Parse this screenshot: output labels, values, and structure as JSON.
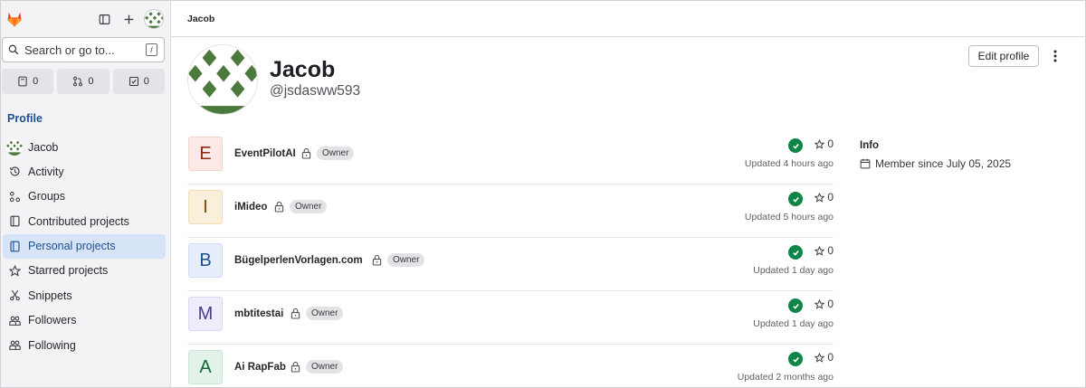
{
  "sidebar": {
    "search_label": "Search or go to...",
    "search_shortcut": "/",
    "counts": [
      {
        "icon": "issues-icon",
        "value": "0"
      },
      {
        "icon": "merge-request-icon",
        "value": "0"
      },
      {
        "icon": "todo-icon",
        "value": "0"
      }
    ],
    "section_title": "Profile",
    "items": [
      {
        "label": "Jacob",
        "icon": "user-avatar"
      },
      {
        "label": "Activity",
        "icon": "history-icon"
      },
      {
        "label": "Groups",
        "icon": "groups-icon"
      },
      {
        "label": "Contributed projects",
        "icon": "project-icon"
      },
      {
        "label": "Personal projects",
        "icon": "project-icon"
      },
      {
        "label": "Starred projects",
        "icon": "star-icon"
      },
      {
        "label": "Snippets",
        "icon": "snippet-icon"
      },
      {
        "label": "Followers",
        "icon": "users-icon"
      },
      {
        "label": "Following",
        "icon": "users-icon"
      }
    ]
  },
  "header": {
    "breadcrumb": "Jacob"
  },
  "profile": {
    "name": "Jacob",
    "handle": "@jsdasww593",
    "edit_label": "Edit profile"
  },
  "projects": [
    {
      "initial": "E",
      "name": "EventPilotAI",
      "role": "Owner",
      "stars": "0",
      "updated": "Updated 4 hours ago",
      "bg": "#fbe9e5",
      "fg": "#8f2a13"
    },
    {
      "initial": "I",
      "name": "iMideo",
      "role": "Owner",
      "stars": "0",
      "updated": "Updated 5 hours ago",
      "bg": "#f9efdb",
      "fg": "#7a4a0c"
    },
    {
      "initial": "B",
      "name": "BügelperlenVorlagen.com",
      "role": "Owner",
      "stars": "0",
      "updated": "Updated 1 day ago",
      "bg": "#e7eefb",
      "fg": "#1d4f91"
    },
    {
      "initial": "M",
      "name": "mbtitestai",
      "role": "Owner",
      "stars": "0",
      "updated": "Updated 1 day ago",
      "bg": "#efebfa",
      "fg": "#4b3c8c"
    },
    {
      "initial": "A",
      "name": "Ai RapFab",
      "role": "Owner",
      "stars": "0",
      "updated": "Updated 2 months ago",
      "bg": "#e3f3e9",
      "fg": "#17653a"
    }
  ],
  "info": {
    "title": "Info",
    "member_since": "Member since July 05, 2025"
  },
  "colors": {
    "accent": "#1d4f91",
    "active_nav": "#d7e4f7",
    "success": "#108548",
    "logo": "#e24329"
  }
}
